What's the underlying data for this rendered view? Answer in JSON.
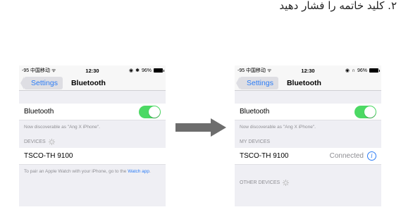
{
  "caption": "۲. کلید خاتمه را فشار دهید",
  "status": {
    "carrier": "-95 中国移动 ᯤ",
    "time": "12:30",
    "battery": "96%"
  },
  "left_phone": {
    "back_label": "Settings",
    "title": "Bluetooth",
    "bluetooth_label": "Bluetooth",
    "discoverable_note": "Now discoverable as \"Ang X iPhone\".",
    "devices_header": "DEVICES",
    "device_name": "TSCO-TH 9100",
    "pair_note_prefix": "To pair an Apple Watch with your iPhone, go to the ",
    "pair_note_link": "Watch app",
    "pair_note_suffix": "."
  },
  "right_phone": {
    "back_label": "Settings",
    "title": "Bluetooth",
    "bluetooth_label": "Bluetooth",
    "discoverable_note": "Now discoverable as \"Ang X iPhone\".",
    "my_devices_header": "MY DEVICES",
    "device_name": "TSCO-TH 9100",
    "device_status": "Connected",
    "other_devices_header": "OTHER DEVICES"
  },
  "colors": {
    "accent": "#2b7cf6",
    "toggle_on": "#4cd964",
    "arrow": "#6d6d6d"
  }
}
